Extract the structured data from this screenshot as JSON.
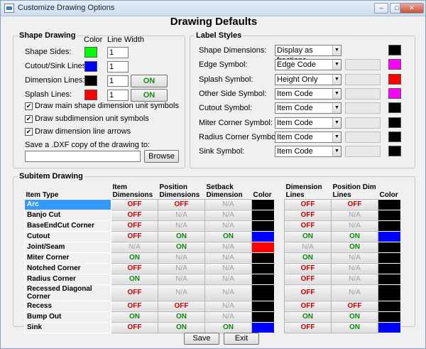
{
  "window": {
    "title": "Customize Drawing Options",
    "heading": "Drawing Defaults",
    "min_glyph": "–",
    "max_glyph": "□",
    "close_glyph": "✕"
  },
  "shape_drawing": {
    "legend": "Shape Drawing",
    "col_color": "Color",
    "col_width": "Line Width",
    "rows": [
      {
        "label": "Shape Sides:",
        "color": "#00ff00",
        "width": "1",
        "button": ""
      },
      {
        "label": "Cutout/Sink Lines:",
        "color": "#0000ff",
        "width": "1",
        "button": ""
      },
      {
        "label": "Dimension Lines:",
        "color": "#000000",
        "width": "1",
        "button": "ON"
      },
      {
        "label": "Splash Lines:",
        "color": "#ff0000",
        "width": "1",
        "button": "ON"
      }
    ],
    "checkboxes": [
      {
        "label": "Draw main shape dimension unit symbols",
        "checked": true,
        "mark": "✔"
      },
      {
        "label": "Draw subdimension unit symbols",
        "checked": true,
        "mark": "✔"
      },
      {
        "label": "Draw dimension line arrows",
        "checked": true,
        "mark": "✔"
      }
    ],
    "dxf_label": "Save a .DXF copy of the drawing to:",
    "dxf_value": "",
    "browse": "Browse"
  },
  "label_styles": {
    "legend": "Label Styles",
    "rows": [
      {
        "label": "Shape Dimensions:",
        "value": "Display as fractions",
        "extra": false,
        "color": "#000000"
      },
      {
        "label": "Edge Symbol:",
        "value": "Edge Code",
        "extra": true,
        "color": "#ff00ff"
      },
      {
        "label": "Splash Symbol:",
        "value": "Height Only",
        "extra": true,
        "color": "#ff0000"
      },
      {
        "label": "Other Side Symbol:",
        "value": "Item Code",
        "extra": true,
        "color": "#ff00ff"
      },
      {
        "label": "Cutout Symbol:",
        "value": "Item Code",
        "extra": true,
        "color": "#000000"
      },
      {
        "label": "Miter Corner Symbol:",
        "value": "Item Code",
        "extra": true,
        "color": "#000000"
      },
      {
        "label": "Radius Corner Symbol:",
        "value": "Item Code",
        "extra": true,
        "color": "#000000"
      },
      {
        "label": "Sink Symbol:",
        "value": "Item Code",
        "extra": true,
        "color": "#000000"
      }
    ],
    "dropdown_arrow": "▼"
  },
  "subitem": {
    "legend": "Subitem Drawing",
    "headers": {
      "item_type": "Item Type",
      "item_dims": "Item Dimensions",
      "pos_dims": "Position Dimensions",
      "setback": "Setback Dimension",
      "color1": "Color",
      "dim_lines": "Dimension Lines",
      "pos_dim_lines": "Position Dim Lines",
      "color2": "Color"
    },
    "rows": [
      {
        "name": "Arc",
        "item_dims": "OFF",
        "pos_dims": "OFF",
        "setback": "N/A",
        "color1": "#000000",
        "dim_lines": "OFF",
        "pos_dim_lines": "OFF",
        "color2": "#000000",
        "selected": true
      },
      {
        "name": "Banjo Cut",
        "item_dims": "OFF",
        "pos_dims": "N/A",
        "setback": "N/A",
        "color1": "#000000",
        "dim_lines": "OFF",
        "pos_dim_lines": "N/A",
        "color2": "#000000"
      },
      {
        "name": "BaseEndCut Corner",
        "item_dims": "OFF",
        "pos_dims": "N/A",
        "setback": "N/A",
        "color1": "#000000",
        "dim_lines": "OFF",
        "pos_dim_lines": "N/A",
        "color2": "#000000"
      },
      {
        "name": "Cutout",
        "item_dims": "OFF",
        "pos_dims": "ON",
        "setback": "ON",
        "color1": "#0000ff",
        "dim_lines": "ON",
        "pos_dim_lines": "ON",
        "color2": "#0000ff"
      },
      {
        "name": "Joint/Seam",
        "item_dims": "N/A",
        "pos_dims": "ON",
        "setback": "N/A",
        "color1": "#ff0000",
        "dim_lines": "N/A",
        "pos_dim_lines": "ON",
        "color2": "#000000"
      },
      {
        "name": "Miter Corner",
        "item_dims": "ON",
        "pos_dims": "N/A",
        "setback": "N/A",
        "color1": "#000000",
        "dim_lines": "ON",
        "pos_dim_lines": "N/A",
        "color2": "#000000"
      },
      {
        "name": "Notched Corner",
        "item_dims": "OFF",
        "pos_dims": "N/A",
        "setback": "N/A",
        "color1": "#000000",
        "dim_lines": "OFF",
        "pos_dim_lines": "N/A",
        "color2": "#000000"
      },
      {
        "name": "Radius Corner",
        "item_dims": "ON",
        "pos_dims": "N/A",
        "setback": "N/A",
        "color1": "#000000",
        "dim_lines": "OFF",
        "pos_dim_lines": "N/A",
        "color2": "#000000"
      },
      {
        "name": "Recessed Diagonal Corner",
        "item_dims": "OFF",
        "pos_dims": "N/A",
        "setback": "N/A",
        "color1": "#000000",
        "dim_lines": "OFF",
        "pos_dim_lines": "N/A",
        "color2": "#000000"
      },
      {
        "name": "Recess",
        "item_dims": "OFF",
        "pos_dims": "OFF",
        "setback": "N/A",
        "color1": "#000000",
        "dim_lines": "OFF",
        "pos_dim_lines": "OFF",
        "color2": "#000000"
      },
      {
        "name": "Bump Out",
        "item_dims": "ON",
        "pos_dims": "ON",
        "setback": "N/A",
        "color1": "#000000",
        "dim_lines": "ON",
        "pos_dim_lines": "ON",
        "color2": "#000000"
      },
      {
        "name": "Sink",
        "item_dims": "OFF",
        "pos_dims": "ON",
        "setback": "ON",
        "color1": "#0000ff",
        "dim_lines": "OFF",
        "pos_dim_lines": "ON",
        "color2": "#0000ff"
      }
    ]
  },
  "footer": {
    "save": "Save",
    "exit": "Exit"
  }
}
